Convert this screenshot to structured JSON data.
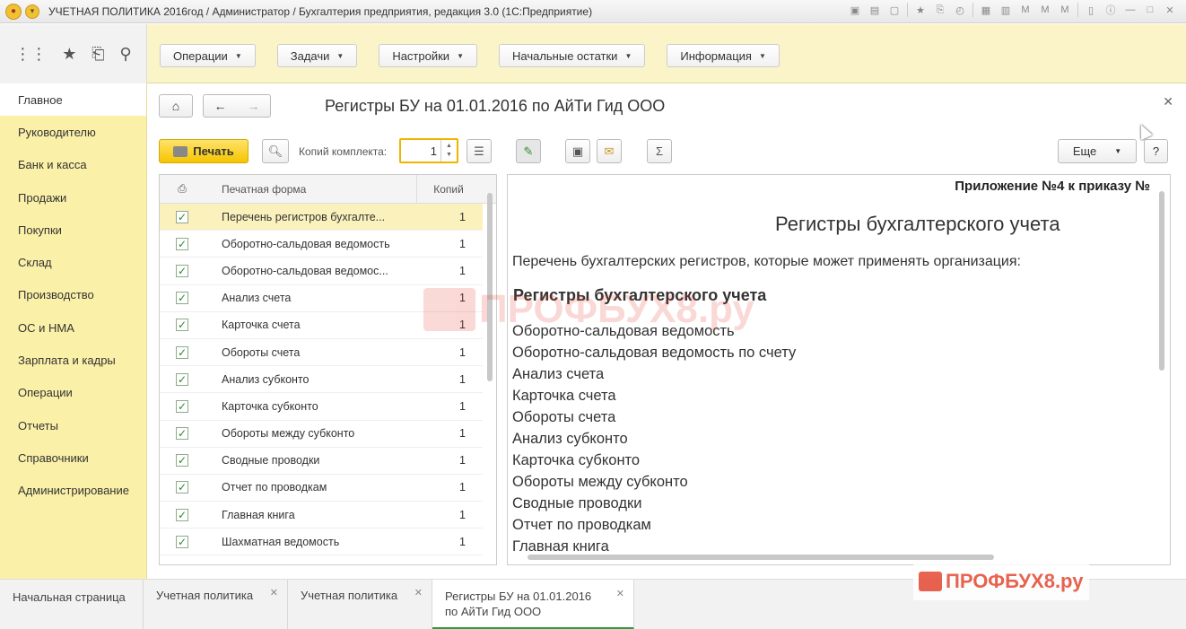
{
  "window": {
    "title": "УЧЕТНАЯ ПОЛИТИКА 2016год / Администратор / Бухгалтерия предприятия, редакция 3.0  (1С:Предприятие)"
  },
  "sections": [
    {
      "label": "Операции"
    },
    {
      "label": "Задачи"
    },
    {
      "label": "Настройки"
    },
    {
      "label": "Начальные остатки"
    },
    {
      "label": "Информация"
    }
  ],
  "sidebar": {
    "items": [
      {
        "label": "Главное"
      },
      {
        "label": "Руководителю"
      },
      {
        "label": "Банк и касса"
      },
      {
        "label": "Продажи"
      },
      {
        "label": "Покупки"
      },
      {
        "label": "Склад"
      },
      {
        "label": "Производство"
      },
      {
        "label": "ОС и НМА"
      },
      {
        "label": "Зарплата и кадры"
      },
      {
        "label": "Операции"
      },
      {
        "label": "Отчеты"
      },
      {
        "label": "Справочники"
      },
      {
        "label": "Администрирование"
      }
    ]
  },
  "form": {
    "title": "Регистры БУ на 01.01.2016 по АйТи Гид ООО",
    "print_label": "Печать",
    "copies_label": "Копий комплекта:",
    "copies_value": "1",
    "more_label": "Еще",
    "help_label": "?"
  },
  "table": {
    "headers": {
      "form": "Печатная форма",
      "copies": "Копий"
    },
    "rows": [
      {
        "name": "Перечень регистров бухгалте...",
        "copies": "1"
      },
      {
        "name": "Оборотно-сальдовая ведомость",
        "copies": "1"
      },
      {
        "name": "Оборотно-сальдовая ведомос...",
        "copies": "1"
      },
      {
        "name": "Анализ счета",
        "copies": "1"
      },
      {
        "name": "Карточка счета",
        "copies": "1"
      },
      {
        "name": "Обороты счета",
        "copies": "1"
      },
      {
        "name": "Анализ субконто",
        "copies": "1"
      },
      {
        "name": "Карточка субконто",
        "copies": "1"
      },
      {
        "name": "Обороты между субконто",
        "copies": "1"
      },
      {
        "name": "Сводные проводки",
        "copies": "1"
      },
      {
        "name": "Отчет по проводкам",
        "copies": "1"
      },
      {
        "name": "Главная книга",
        "copies": "1"
      },
      {
        "name": "Шахматная ведомость",
        "copies": "1"
      }
    ]
  },
  "document": {
    "appendix": "Приложение №4 к приказу №",
    "title": "Регистры бухгалтерского учета",
    "intro": "Перечень бухгалтерских регистров, которые может применять организация:",
    "heading": "Регистры бухгалтерского учета",
    "items": [
      "Оборотно-сальдовая ведомость",
      "Оборотно-сальдовая ведомость по счету",
      "Анализ счета",
      "Карточка счета",
      "Обороты счета",
      "Анализ субконто",
      "Карточка субконто",
      "Обороты между субконто",
      "Сводные проводки",
      "Отчет по проводкам",
      "Главная книга"
    ]
  },
  "watermark": {
    "text": "ПРОФБУХ8.ру"
  },
  "open_windows": [
    {
      "label": "Начальная страница"
    },
    {
      "label": "Учетная политика"
    },
    {
      "label": "Учетная политика"
    },
    {
      "label": "Регистры БУ на 01.01.2016 по АйТи Гид ООО"
    }
  ]
}
